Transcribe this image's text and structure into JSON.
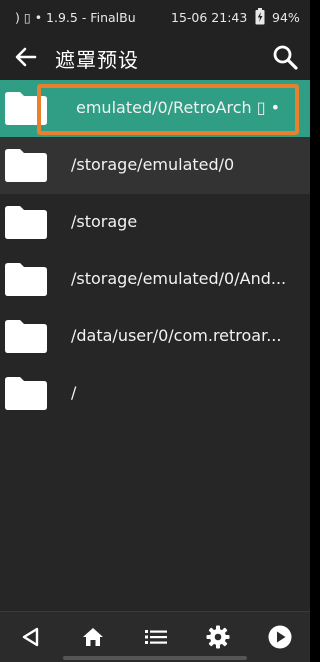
{
  "status_bar": {
    "left_text": ")  ▯ • 1.9.5 - FinalBu",
    "time": "15-06 21:43",
    "battery": "94%"
  },
  "app_bar": {
    "title": "遮罩预设",
    "back_icon": "arrow-left-icon",
    "search_icon": "search-icon"
  },
  "items": [
    {
      "label": "emulated/0/RetroArch ▯ •",
      "icon": "folder-icon",
      "state": "selected"
    },
    {
      "label": "/storage/emulated/0",
      "icon": "folder-icon",
      "state": "focused"
    },
    {
      "label": "/storage",
      "icon": "folder-icon",
      "state": "normal"
    },
    {
      "label": "/storage/emulated/0/And...",
      "icon": "folder-icon",
      "state": "normal"
    },
    {
      "label": "/data/user/0/com.retroar...",
      "icon": "folder-icon",
      "state": "normal"
    },
    {
      "label": "/",
      "icon": "folder-icon",
      "state": "normal"
    }
  ],
  "nav_bar": {
    "buttons": [
      "back-triangle-icon",
      "home-icon",
      "list-icon",
      "gear-icon",
      "play-circle-icon"
    ]
  },
  "colors": {
    "selected_row": "#2f9e84",
    "highlight_border": "#e8812e",
    "background": "#262626"
  }
}
